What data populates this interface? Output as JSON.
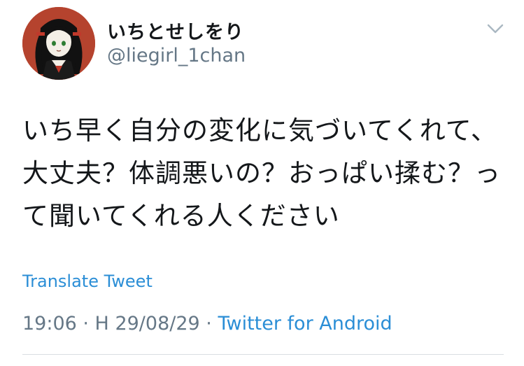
{
  "tweet": {
    "author": {
      "display_name": "いちとせしをり",
      "handle": "@liegirl_1chan"
    },
    "text": "いち早く自分の変化に気づいてくれて、大丈夫？体調悪いの？おっぱい揉む？って聞いてくれる人ください",
    "translate_label": "Translate Tweet",
    "timestamp": "19:06 · H 29/08/29",
    "separator": " · ",
    "source": "Twitter for Android"
  },
  "icons": {
    "menu": "chevron-down-icon",
    "avatar": "profile-avatar"
  },
  "colors": {
    "link": "#2b8ed6",
    "secondary_text": "#657786",
    "primary_text": "#14171a",
    "avatar_background": "#b5432e"
  }
}
